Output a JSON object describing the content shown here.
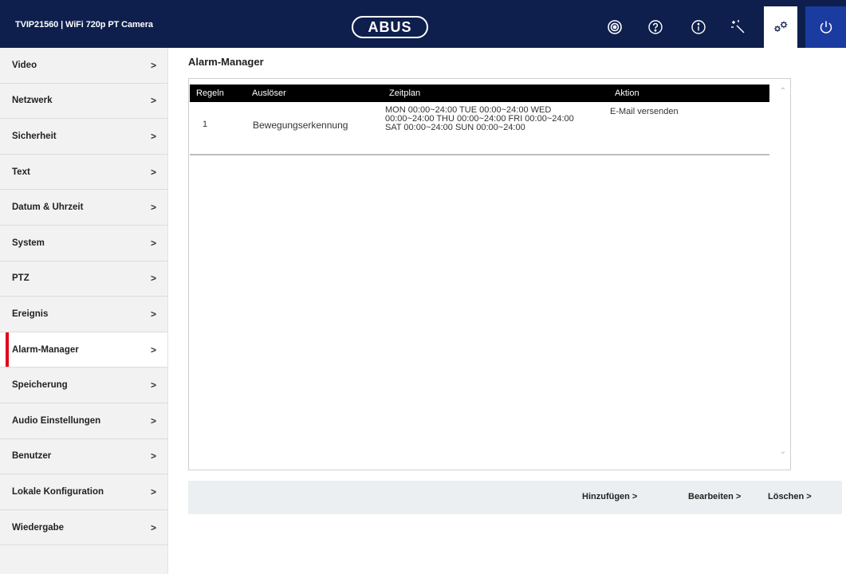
{
  "header": {
    "camera_title": "TVIP21560 | WiFi 720p PT Camera",
    "logo_text": "ABUS",
    "icons": [
      "live-view-icon",
      "help-icon",
      "info-icon",
      "wizard-icon",
      "settings-icon",
      "power-icon"
    ]
  },
  "sidebar": {
    "items": [
      {
        "label": "Video",
        "chev": ">"
      },
      {
        "label": "Netzwerk",
        "chev": ">"
      },
      {
        "label": "Sicherheit",
        "chev": ">"
      },
      {
        "label": "Text",
        "chev": ">"
      },
      {
        "label": "Datum & Uhrzeit",
        "chev": ">"
      },
      {
        "label": "System",
        "chev": ">"
      },
      {
        "label": "PTZ",
        "chev": ">"
      },
      {
        "label": "Ereignis",
        "chev": ">"
      },
      {
        "label": "Alarm-Manager",
        "chev": ">"
      },
      {
        "label": "Speicherung",
        "chev": ">"
      },
      {
        "label": "Audio Einstellungen",
        "chev": ">"
      },
      {
        "label": "Benutzer",
        "chev": ">"
      },
      {
        "label": "Lokale Konfiguration",
        "chev": ">"
      },
      {
        "label": "Wiedergabe",
        "chev": ">"
      }
    ],
    "active": "Alarm-Manager"
  },
  "main": {
    "title": "Alarm-Manager",
    "table": {
      "columns": [
        "Regeln",
        "Auslöser",
        "Zeitplan",
        "Aktion"
      ],
      "rows": [
        {
          "regeln": "1",
          "ausloeser": "Bewegungserkennung",
          "zeitplan": "MON 00:00~24:00 TUE 00:00~24:00 WED 00:00~24:00 THU 00:00~24:00 FRI 00:00~24:00 SAT 00:00~24:00 SUN 00:00~24:00",
          "aktion": "E-Mail versenden"
        }
      ]
    },
    "actions": {
      "add": "Hinzufügen  >",
      "edit": "Bearbeiten  >",
      "delete": "Löschen  >"
    }
  },
  "colors": {
    "header_bg": "#0e1f4d",
    "power_bg": "#1a3ba0",
    "active_marker": "#e2001a",
    "sidebar_bg": "#f2f2f2"
  }
}
